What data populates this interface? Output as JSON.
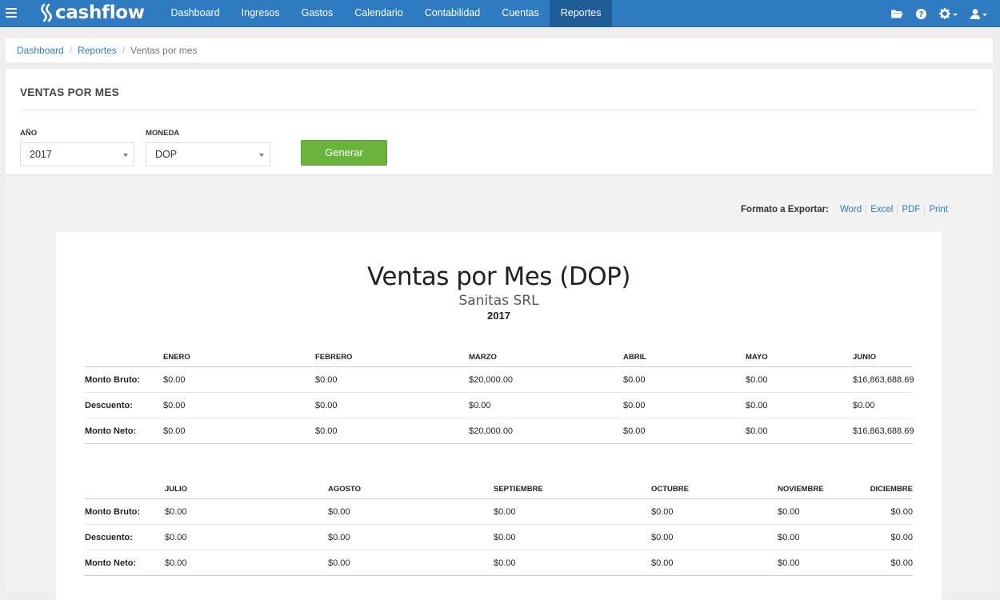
{
  "nav": {
    "brand": "cashflow",
    "items": [
      {
        "label": "Dashboard"
      },
      {
        "label": "Ingresos"
      },
      {
        "label": "Gastos"
      },
      {
        "label": "Calendario"
      },
      {
        "label": "Contabilidad"
      },
      {
        "label": "Cuentas"
      },
      {
        "label": "Reportes",
        "active": true
      }
    ],
    "right_icons": [
      "folder-icon",
      "help-icon",
      "gear-icon",
      "user-icon"
    ]
  },
  "breadcrumb": {
    "items": [
      "Dashboard",
      "Reportes"
    ],
    "current": "Ventas por mes"
  },
  "page": {
    "title": "VENTAS POR MES",
    "year_label": "AÑO",
    "year_value": "2017",
    "currency_label": "MONEDA",
    "currency_value": "DOP",
    "generate_label": "Generar"
  },
  "export": {
    "label": "Formato a Exportar:",
    "links": [
      "Word",
      "Excel",
      "PDF",
      "Print"
    ]
  },
  "report": {
    "title": "Ventas por Mes (DOP)",
    "company": "Sanitas SRL",
    "year": "2017",
    "row_labels": [
      "Monto Bruto:",
      "Descuento:",
      "Monto Neto:"
    ],
    "table1": {
      "months": [
        "ENERO",
        "FEBRERO",
        "MARZO",
        "ABRIL",
        "MAYO",
        "JUNIO"
      ],
      "rows": [
        [
          "$0.00",
          "$0.00",
          "$20,000.00",
          "$0.00",
          "$0.00",
          "$16,863,688.69"
        ],
        [
          "$0.00",
          "$0.00",
          "$0.00",
          "$0.00",
          "$0.00",
          "$0.00"
        ],
        [
          "$0.00",
          "$0.00",
          "$20,000.00",
          "$0.00",
          "$0.00",
          "$16,863,688.69"
        ]
      ]
    },
    "table2": {
      "months": [
        "JULIO",
        "AGOSTO",
        "SEPTIEMBRE",
        "OCTUBRE",
        "NOVIEMBRE",
        "DICIEMBRE"
      ],
      "rows": [
        [
          "$0.00",
          "$0.00",
          "$0.00",
          "$0.00",
          "$0.00",
          "$0.00"
        ],
        [
          "$0.00",
          "$0.00",
          "$0.00",
          "$0.00",
          "$0.00",
          "$0.00"
        ],
        [
          "$0.00",
          "$0.00",
          "$0.00",
          "$0.00",
          "$0.00",
          "$0.00"
        ]
      ]
    }
  }
}
